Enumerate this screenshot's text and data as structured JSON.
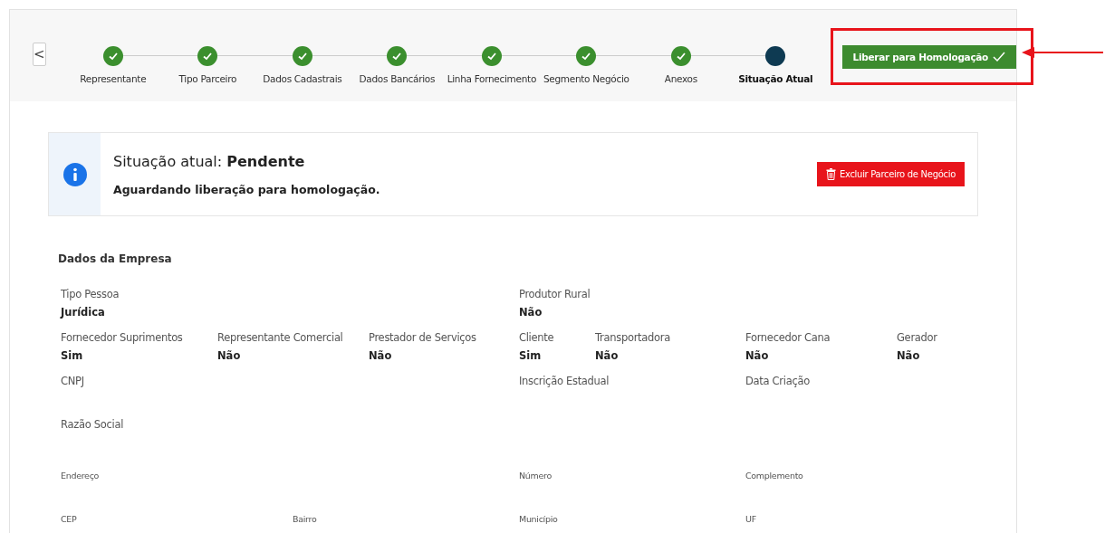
{
  "back_button": {
    "label": "<"
  },
  "steps": [
    {
      "label": "Representante",
      "completed": true,
      "selected": false
    },
    {
      "label": "Tipo Parceiro",
      "completed": true,
      "selected": false
    },
    {
      "label": "Dados Cadastrais",
      "completed": true,
      "selected": false
    },
    {
      "label": "Dados Bancários",
      "completed": true,
      "selected": false
    },
    {
      "label": "Linha Fornecimento",
      "completed": true,
      "selected": false
    },
    {
      "label": "Segmento Negócio",
      "completed": true,
      "selected": false
    },
    {
      "label": "Anexos",
      "completed": true,
      "selected": false
    },
    {
      "label": "Situação Atual",
      "completed": false,
      "selected": true
    }
  ],
  "release_button": {
    "label": "Liberar para Homologação",
    "highlighted": true
  },
  "status_card": {
    "title": "Situação atual: **Pendente**",
    "message": "Aguardando liberação para homologação.",
    "delete_button": "Excluir Parceiro de Negócio"
  },
  "section_title": "Dados da Empresa",
  "rows": [
    {
      "kind": "pair",
      "fields": [
        {
          "label": "Tipo Pessoa",
          "value": "Jurídica"
        },
        {
          "label": "Produtor Rural",
          "value": "Não"
        }
      ]
    },
    {
      "kind": "flags",
      "fields": [
        {
          "label": "Fornecedor Suprimentos",
          "value": "Sim"
        },
        {
          "label": "Representante Comercial",
          "value": "Não"
        },
        {
          "label": "Prestador de Serviços",
          "value": "Não"
        },
        {
          "label": "Cliente",
          "value": "Sim"
        },
        {
          "label": "Transportadora",
          "value": "Não"
        },
        {
          "label": "Fornecedor Cana",
          "value": "Não"
        },
        {
          "label": "Gerador",
          "value": "Não"
        }
      ]
    },
    {
      "kind": "triple",
      "fields": [
        {
          "label": "CNPJ"
        },
        {
          "label": "Inscrição Estadual"
        },
        {
          "label": "Data Criação"
        }
      ]
    },
    {
      "kind": "single",
      "fields": [
        {
          "label": "Razão Social"
        }
      ]
    },
    {
      "kind": "address3",
      "fields": [
        {
          "label": "Endereço"
        },
        {
          "label": "Número"
        },
        {
          "label": "Complemento"
        }
      ]
    },
    {
      "kind": "address4",
      "fields": [
        {
          "label": "CEP"
        },
        {
          "label": "Bairro"
        },
        {
          "label": "Município"
        },
        {
          "label": "UF"
        }
      ]
    }
  ]
}
